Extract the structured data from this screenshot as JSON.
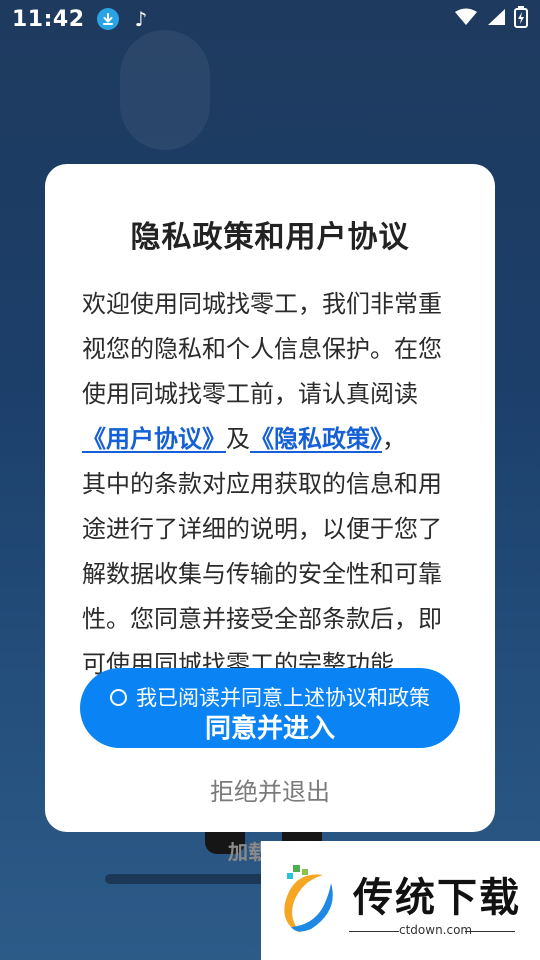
{
  "status_bar": {
    "time": "11:42"
  },
  "dialog": {
    "title": "隐私政策和用户协议",
    "intro": "欢迎使用同城找零工，我们非常重视您的隐私和个人信息保护。在您使用同城找零工前，请认真阅读",
    "user_agreement_link": "《用户协议》",
    "and": "及",
    "privacy_policy_link": "《隐私政策》",
    "comma": "，",
    "body": "其中的条款对应用获取的信息和用途进行了详细的说明，以便于您了解数据收集与传输的安全性和可靠性。您同意并接受全部条款后，即可使用同城找零工的完整功能",
    "consent_label": "我已阅读并同意上述协议和政策",
    "agree_button": "同意并进入",
    "refuse_button": "拒绝并退出"
  },
  "background": {
    "loading_fragment": "加载"
  },
  "watermark": {
    "brand": "传统下载",
    "domain": "ctdown.com"
  },
  "colors": {
    "accent": "#0a84f5",
    "link": "#1560d6",
    "background": "#1e3a5e"
  }
}
